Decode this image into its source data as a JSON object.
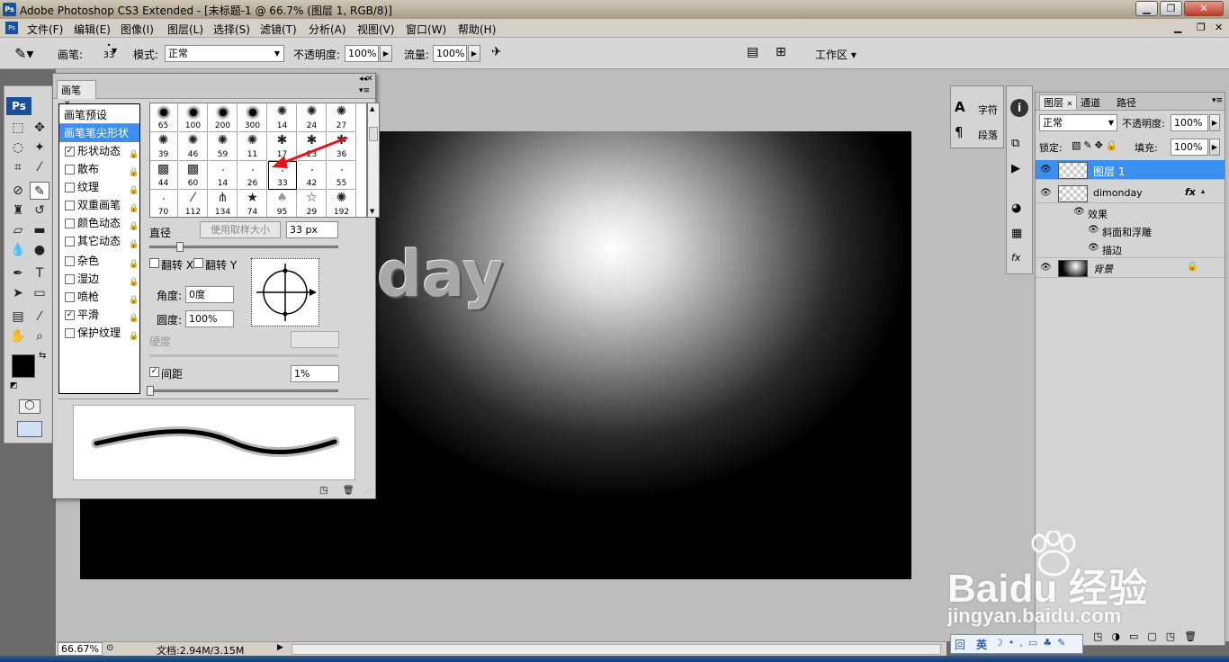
{
  "window": {
    "title": "Adobe Photoshop CS3 Extended - [未标题-1 @ 66.7% (图层 1, RGB/8)]",
    "app_icon_label": "Ps"
  },
  "menu": [
    "文件(F)",
    "编辑(E)",
    "图像(I)",
    "图层(L)",
    "选择(S)",
    "滤镜(T)",
    "分析(A)",
    "视图(V)",
    "窗口(W)",
    "帮助(H)"
  ],
  "options": {
    "brush_label": "画笔:",
    "brush_size": "33",
    "mode_label": "模式:",
    "mode_value": "正常",
    "opacity_label": "不透明度:",
    "opacity_value": "100%",
    "flow_label": "流量:",
    "flow_value": "100%",
    "workspace_label": "工作区"
  },
  "canvas": {
    "visible_text": "day"
  },
  "status": {
    "zoom": "66.67%",
    "doc": "文档:2.94M/3.15M"
  },
  "brush_panel": {
    "tab": "画笔",
    "items": [
      {
        "label": "画笔预设",
        "check": false,
        "checked": false,
        "lock": false,
        "selected": false
      },
      {
        "label": "画笔笔尖形状",
        "check": false,
        "checked": false,
        "lock": false,
        "selected": true
      },
      {
        "label": "形状动态",
        "check": true,
        "checked": true,
        "lock": true,
        "selected": false
      },
      {
        "label": "散布",
        "check": true,
        "checked": false,
        "lock": true,
        "selected": false
      },
      {
        "label": "纹理",
        "check": true,
        "checked": false,
        "lock": true,
        "selected": false
      },
      {
        "label": "双重画笔",
        "check": true,
        "checked": false,
        "lock": true,
        "selected": false
      },
      {
        "label": "颜色动态",
        "check": true,
        "checked": false,
        "lock": true,
        "selected": false
      },
      {
        "label": "其它动态",
        "check": true,
        "checked": false,
        "lock": true,
        "selected": false
      },
      {
        "label": "杂色",
        "check": true,
        "checked": false,
        "lock": true,
        "selected": false
      },
      {
        "label": "湿边",
        "check": true,
        "checked": false,
        "lock": true,
        "selected": false
      },
      {
        "label": "喷枪",
        "check": true,
        "checked": false,
        "lock": true,
        "selected": false
      },
      {
        "label": "平滑",
        "check": true,
        "checked": true,
        "lock": true,
        "selected": false
      },
      {
        "label": "保护纹理",
        "check": true,
        "checked": false,
        "lock": true,
        "selected": false
      }
    ],
    "tips": [
      {
        "size": "65",
        "kind": "soft"
      },
      {
        "size": "100",
        "kind": "soft"
      },
      {
        "size": "200",
        "kind": "soft"
      },
      {
        "size": "300",
        "kind": "soft"
      },
      {
        "size": "14",
        "kind": "splat"
      },
      {
        "size": "24",
        "kind": "splat"
      },
      {
        "size": "27",
        "kind": "splat"
      },
      {
        "size": "39",
        "kind": "splat"
      },
      {
        "size": "46",
        "kind": "splat"
      },
      {
        "size": "59",
        "kind": "splat"
      },
      {
        "size": "11",
        "kind": "splat"
      },
      {
        "size": "17",
        "kind": "leaf"
      },
      {
        "size": "23",
        "kind": "leaf"
      },
      {
        "size": "36",
        "kind": "leaf"
      },
      {
        "size": "44",
        "kind": "chalk"
      },
      {
        "size": "60",
        "kind": "chalk"
      },
      {
        "size": "14",
        "kind": "tiny"
      },
      {
        "size": "26",
        "kind": "tiny"
      },
      {
        "size": "33",
        "kind": "tiny"
      },
      {
        "size": "42",
        "kind": "tiny"
      },
      {
        "size": "55",
        "kind": "tiny"
      },
      {
        "size": "70",
        "kind": "tiny"
      },
      {
        "size": "112",
        "kind": "stroke"
      },
      {
        "size": "134",
        "kind": "grass"
      },
      {
        "size": "74",
        "kind": "star"
      },
      {
        "size": "95",
        "kind": "leafgray"
      },
      {
        "size": "29",
        "kind": "staro"
      },
      {
        "size": "192",
        "kind": "splat"
      }
    ],
    "diameter_label": "直径",
    "use_sample_size": "使用取样大小",
    "diameter_value": "33 px",
    "flip_x": "翻转 X",
    "flip_y": "翻转 Y",
    "angle_label": "角度:",
    "angle_value": "0度",
    "roundness_label": "圆度:",
    "roundness_value": "100%",
    "hardness_label": "硬度",
    "spacing_label": "间距",
    "spacing_value": "1%"
  },
  "right_panels": {
    "char_tabs": [
      "字符",
      "段落"
    ]
  },
  "layers_panel": {
    "tabs": [
      "图层",
      "通道",
      "路径"
    ],
    "blend_mode": "正常",
    "opacity_label": "不透明度:",
    "opacity_value": "100%",
    "lock_label": "锁定:",
    "fill_label": "填充:",
    "fill_value": "100%",
    "layers": [
      {
        "name": "图层 1",
        "selected": true
      },
      {
        "name": "dimonday",
        "fx": "fx"
      },
      {
        "name": "效果",
        "effect_group": true
      },
      {
        "name": "斜面和浮雕",
        "effect": true
      },
      {
        "name": "描边",
        "effect": true
      },
      {
        "name": "背景",
        "locked": true
      }
    ]
  },
  "watermark": {
    "brand": "Baidu 经验",
    "url": "jingyan.baidu.com"
  },
  "ime": {
    "lang": "英"
  }
}
